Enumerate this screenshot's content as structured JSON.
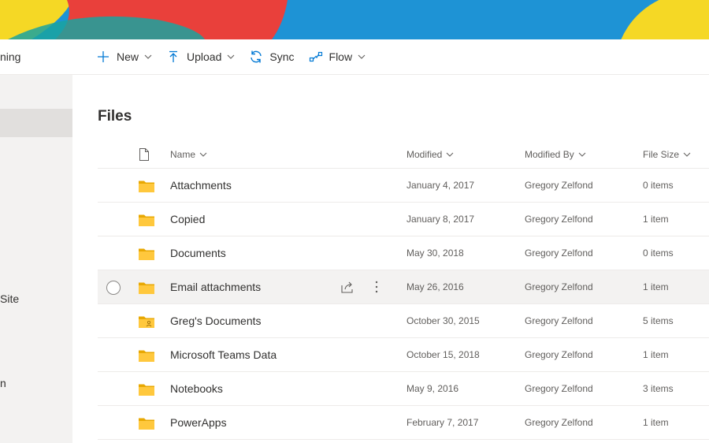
{
  "banner": {
    "colors": {
      "blue": "#1e93d5",
      "red": "#e9403b",
      "yellow": "#f5d825",
      "teal": "#1aa3a0"
    }
  },
  "leftnav": {
    "items": [
      {
        "label": "ning"
      },
      {
        "label": "Site"
      },
      {
        "label": "n"
      }
    ]
  },
  "commandbar": {
    "new": {
      "label": "New",
      "icon": "plus-icon"
    },
    "upload": {
      "label": "Upload",
      "icon": "upload-arrow-icon"
    },
    "sync": {
      "label": "Sync",
      "icon": "sync-icon"
    },
    "flow": {
      "label": "Flow",
      "icon": "flow-icon"
    }
  },
  "page": {
    "title": "Files"
  },
  "table": {
    "columns": {
      "type": {
        "icon": "file-type-icon"
      },
      "name": "Name",
      "modified": "Modified",
      "modified_by": "Modified By",
      "file_size": "File Size"
    },
    "rows": [
      {
        "name": "Attachments",
        "modified": "January 4, 2017",
        "modified_by": "Gregory Zelfond",
        "file_size": "0 items"
      },
      {
        "name": "Copied",
        "modified": "January 8, 2017",
        "modified_by": "Gregory Zelfond",
        "file_size": "1 item"
      },
      {
        "name": "Documents",
        "modified": "May 30, 2018",
        "modified_by": "Gregory Zelfond",
        "file_size": "0 items"
      },
      {
        "name": "Email attachments",
        "modified": "May 26, 2016",
        "modified_by": "Gregory Zelfond",
        "file_size": "1 item"
      },
      {
        "name": "Greg's Documents",
        "modified": "October 30, 2015",
        "modified_by": "Gregory Zelfond",
        "file_size": "5 items"
      },
      {
        "name": "Microsoft Teams Data",
        "modified": "October 15, 2018",
        "modified_by": "Gregory Zelfond",
        "file_size": "1 item"
      },
      {
        "name": "Notebooks",
        "modified": "May 9, 2016",
        "modified_by": "Gregory Zelfond",
        "file_size": "3 items"
      },
      {
        "name": "PowerApps",
        "modified": "February 7, 2017",
        "modified_by": "Gregory Zelfond",
        "file_size": "1 item"
      }
    ]
  }
}
